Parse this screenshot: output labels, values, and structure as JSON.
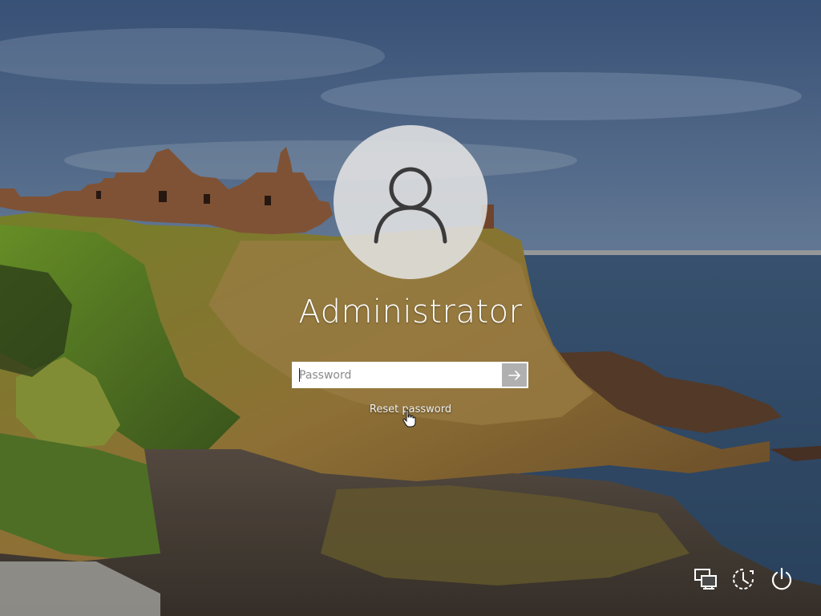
{
  "user": {
    "name": "Administrator",
    "avatar_icon": "user-silhouette-icon"
  },
  "password": {
    "placeholder": "Password",
    "value": "",
    "submit_icon": "arrow-right-icon"
  },
  "reset_link": "Reset password",
  "tray": {
    "network_icon": "network-icon",
    "accessibility_icon": "ease-of-access-icon",
    "power_icon": "power-icon"
  }
}
